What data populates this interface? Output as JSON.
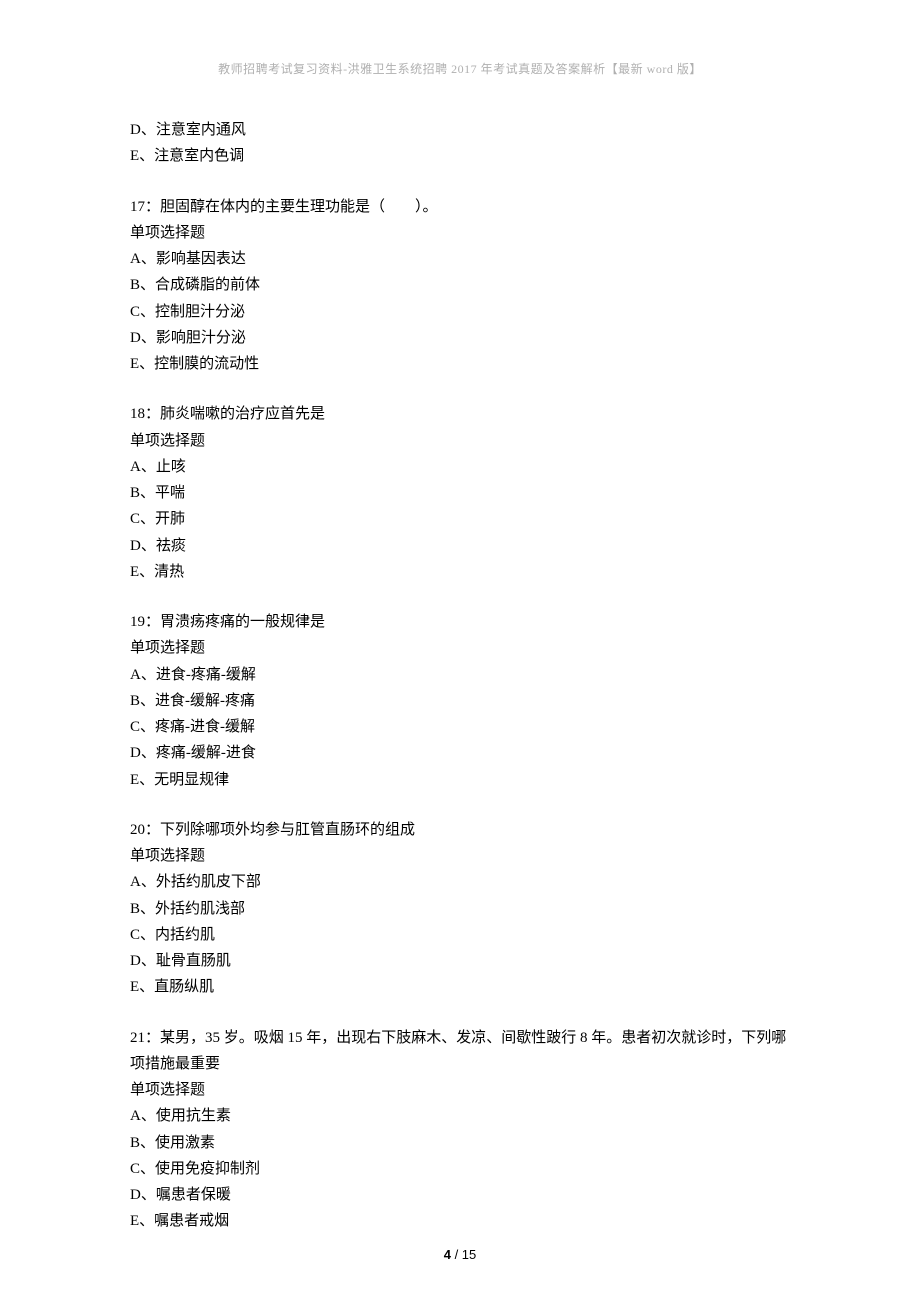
{
  "header": "教师招聘考试复习资料-洪雅卫生系统招聘 2017 年考试真题及答案解析【最新 word 版】",
  "blocks": [
    {
      "lines": [
        "D、注意室内通风",
        "E、注意室内色调"
      ]
    },
    {
      "lines": [
        "17：胆固醇在体内的主要生理功能是（　　）。",
        "单项选择题",
        "A、影响基因表达",
        "B、合成磷脂的前体",
        "C、控制胆汁分泌",
        "D、影响胆汁分泌",
        "E、控制膜的流动性"
      ]
    },
    {
      "lines": [
        "18：肺炎喘嗽的治疗应首先是",
        "单项选择题",
        "A、止咳",
        "B、平喘",
        "C、开肺",
        "D、祛痰",
        "E、清热"
      ]
    },
    {
      "lines": [
        "19：胃溃疡疼痛的一般规律是",
        "单项选择题",
        "A、进食-疼痛-缓解",
        "B、进食-缓解-疼痛",
        "C、疼痛-进食-缓解",
        "D、疼痛-缓解-进食",
        "E、无明显规律"
      ]
    },
    {
      "lines": [
        "20：下列除哪项外均参与肛管直肠环的组成",
        "单项选择题",
        "A、外括约肌皮下部",
        "B、外括约肌浅部",
        "C、内括约肌",
        "D、耻骨直肠肌",
        "E、直肠纵肌"
      ]
    },
    {
      "lines": [
        "21：某男，35 岁。吸烟 15 年，出现右下肢麻木、发凉、间歇性跛行 8 年。患者初次就诊时，下列哪项措施最重要",
        "单项选择题",
        "A、使用抗生素",
        "B、使用激素",
        "C、使用免疫抑制剂",
        "D、嘱患者保暖",
        "E、嘱患者戒烟"
      ]
    }
  ],
  "pager": {
    "current": "4",
    "sep": " / ",
    "total": "15"
  }
}
